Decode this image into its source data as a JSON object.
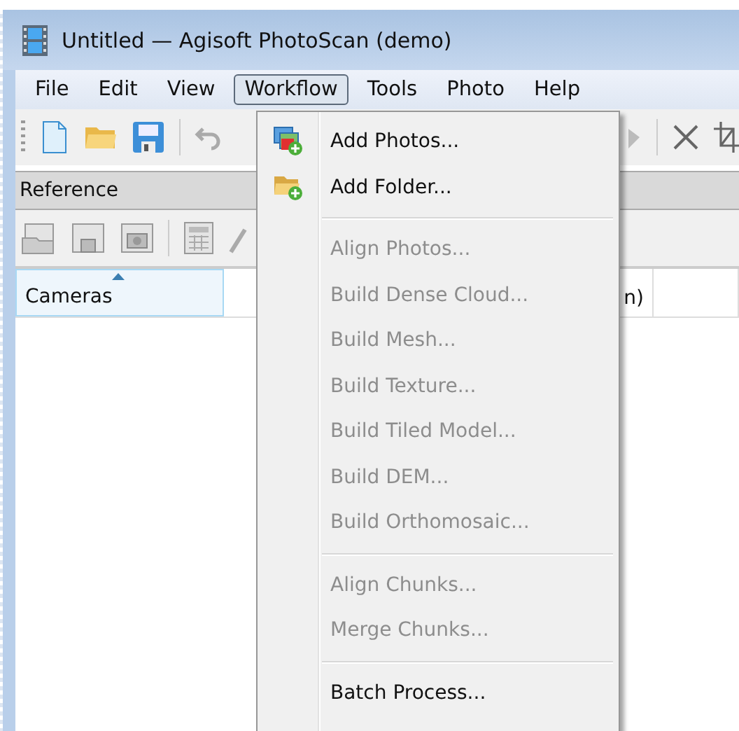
{
  "window": {
    "title": "Untitled — Agisoft PhotoScan (demo)"
  },
  "menu_bar": [
    {
      "label": "File",
      "selected": false
    },
    {
      "label": "Edit",
      "selected": false
    },
    {
      "label": "View",
      "selected": false
    },
    {
      "label": "Workflow",
      "selected": true
    },
    {
      "label": "Tools",
      "selected": false
    },
    {
      "label": "Photo",
      "selected": false
    },
    {
      "label": "Help",
      "selected": false
    }
  ],
  "reference_panel": {
    "title": "Reference",
    "columns": [
      {
        "label": "Cameras",
        "sorted": true
      },
      {
        "label": "n)",
        "sorted": false
      }
    ]
  },
  "workflow_menu": [
    {
      "kind": "item",
      "label": "Add Photos...",
      "disabled": false
    },
    {
      "kind": "item",
      "label": "Add Folder...",
      "disabled": false
    },
    {
      "kind": "separator"
    },
    {
      "kind": "item",
      "label": "Align Photos...",
      "disabled": true
    },
    {
      "kind": "item",
      "label": "Build Dense Cloud...",
      "disabled": true
    },
    {
      "kind": "item",
      "label": "Build Mesh...",
      "disabled": true
    },
    {
      "kind": "item",
      "label": "Build Texture...",
      "disabled": true
    },
    {
      "kind": "item",
      "label": "Build Tiled Model...",
      "disabled": true
    },
    {
      "kind": "item",
      "label": "Build DEM...",
      "disabled": true
    },
    {
      "kind": "item",
      "label": "Build Orthomosaic...",
      "disabled": true
    },
    {
      "kind": "separator"
    },
    {
      "kind": "item",
      "label": "Align Chunks...",
      "disabled": true
    },
    {
      "kind": "item",
      "label": "Merge Chunks...",
      "disabled": true
    },
    {
      "kind": "separator"
    },
    {
      "kind": "item",
      "label": "Batch Process...",
      "disabled": false
    }
  ]
}
